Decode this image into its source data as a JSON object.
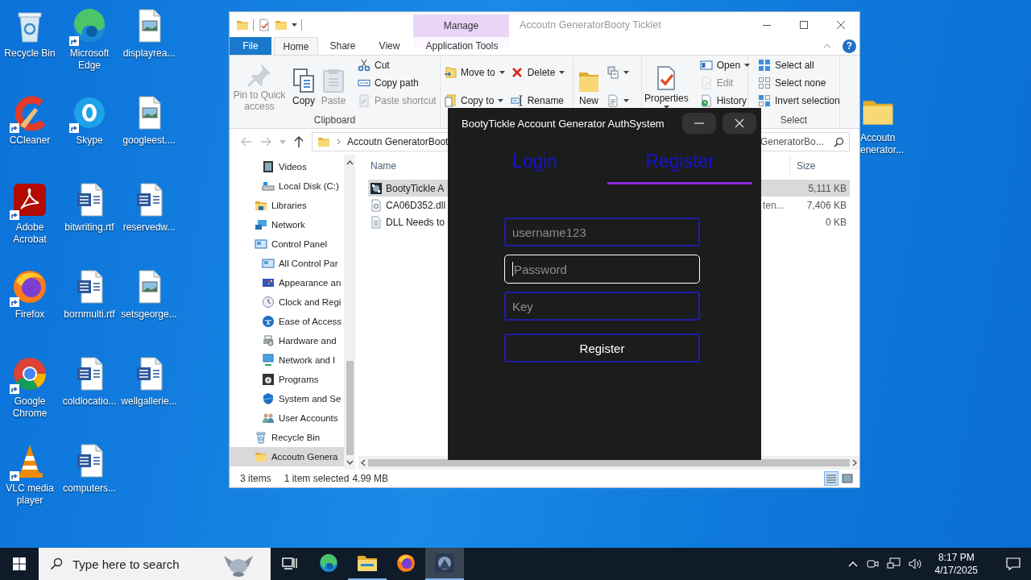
{
  "desktop": {
    "icons": [
      {
        "label": "Recycle Bin",
        "kind": "recycle",
        "shortcut": false
      },
      {
        "label": "CCleaner",
        "kind": "ccleaner",
        "shortcut": true
      },
      {
        "label": "Adobe Acrobat",
        "kind": "acrobat",
        "shortcut": true
      },
      {
        "label": "Firefox",
        "kind": "firefox",
        "shortcut": true
      },
      {
        "label": "Google Chrome",
        "kind": "chrome",
        "shortcut": true
      },
      {
        "label": "VLC media player",
        "kind": "vlc",
        "shortcut": true
      },
      {
        "label": "Microsoft Edge",
        "kind": "edge",
        "shortcut": true
      },
      {
        "label": "Skype",
        "kind": "skype",
        "shortcut": true
      },
      {
        "label": "bitwriting.rtf",
        "kind": "word",
        "shortcut": false
      },
      {
        "label": "bornmulti.rtf",
        "kind": "word",
        "shortcut": false
      },
      {
        "label": "coldlocatio...",
        "kind": "word",
        "shortcut": false
      },
      {
        "label": "computers...",
        "kind": "word",
        "shortcut": false
      },
      {
        "label": "displayrea...",
        "kind": "image",
        "shortcut": false
      },
      {
        "label": "googleest....",
        "kind": "image",
        "shortcut": false
      },
      {
        "label": "reservedw...",
        "kind": "word",
        "shortcut": false
      },
      {
        "label": "setsgeorge...",
        "kind": "image",
        "shortcut": false
      },
      {
        "label": "wellgallerie...",
        "kind": "word",
        "shortcut": false
      }
    ],
    "folder_icon": {
      "label": "Accoutn enerator...",
      "kind": "folder"
    }
  },
  "explorer": {
    "title": "Accoutn GeneratorBooty Ticklet",
    "context_header": "Manage",
    "help": "?",
    "ribbon_tabs": [
      {
        "label": "File",
        "kind": "file",
        "selected": false
      },
      {
        "label": "Home",
        "kind": "plain",
        "selected": true
      },
      {
        "label": "Share",
        "kind": "plain",
        "selected": false
      },
      {
        "label": "View",
        "kind": "plain",
        "selected": false
      },
      {
        "label": "Application Tools",
        "kind": "context",
        "selected": false
      }
    ],
    "ribbon_groups": [
      {
        "label": "Clipboard",
        "columns": [
          [
            {
              "label": "Pin to Quick access",
              "kind": "pin",
              "dropdown": false,
              "disabled": true
            }
          ],
          [
            {
              "label": "Copy",
              "kind": "copy",
              "dropdown": false,
              "disabled": false
            }
          ],
          [
            {
              "label": "Paste",
              "kind": "paste",
              "dropdown": false,
              "disabled": true
            }
          ],
          [
            {
              "label": "Cut",
              "kind": "cut",
              "dropdown": false,
              "disabled": false
            },
            {
              "label": "Copy path",
              "kind": "copypath",
              "dropdown": false,
              "disabled": false
            },
            {
              "label": "Paste shortcut",
              "kind": "pasteshortcut",
              "dropdown": false,
              "disabled": true
            }
          ]
        ]
      },
      {
        "columns": [
          [
            {
              "label": "Move to",
              "kind": "moveto",
              "dropdown": true,
              "disabled": false
            },
            {
              "label": "Copy to",
              "kind": "copyto",
              "dropdown": true,
              "disabled": false
            }
          ],
          [
            {
              "label": "Delete",
              "kind": "delete",
              "dropdown": true,
              "disabled": false
            },
            {
              "label": "Rename",
              "kind": "rename",
              "dropdown": false,
              "disabled": false
            }
          ]
        ]
      },
      {
        "columns": [
          [
            {
              "label": "New",
              "kind": "newfolder",
              "dropdown": false,
              "disabled": false
            }
          ],
          [
            {
              "kind": "newitem",
              "dropdown": true,
              "disabled": false
            },
            {
              "kind": "easyaccess",
              "dropdown": true,
              "disabled": false
            }
          ]
        ]
      },
      {
        "columns": [
          [
            {
              "label": "Properties",
              "kind": "properties",
              "dropdown": true,
              "disabled": false
            }
          ],
          [
            {
              "label": "Open",
              "kind": "open",
              "dropdown": true,
              "disabled": false
            },
            {
              "label": "Edit",
              "kind": "edit",
              "dropdown": false,
              "disabled": true
            },
            {
              "label": "History",
              "kind": "history",
              "dropdown": false,
              "disabled": false
            }
          ]
        ]
      },
      {
        "label": "Select",
        "columns": [
          [
            {
              "label": "Select all",
              "kind": "selectall",
              "dropdown": false,
              "disabled": false
            },
            {
              "label": "Select none",
              "kind": "selectnone",
              "dropdown": false,
              "disabled": false
            },
            {
              "label": "Invert selection",
              "kind": "invert",
              "dropdown": false,
              "disabled": false
            }
          ]
        ]
      }
    ],
    "address": "Accoutn GeneratorBoot",
    "search": "GeneratorBo...",
    "nav": [
      {
        "children": [
          {
            "label": "Videos",
            "kind": "videos",
            "selected": false
          },
          {
            "label": "Local Disk (C:)",
            "kind": "disk",
            "selected": false
          }
        ]
      },
      {
        "label": "Libraries",
        "kind": "libraries",
        "selected": false
      },
      {
        "label": "Network",
        "kind": "network",
        "selected": false
      },
      {
        "label": "Control Panel",
        "kind": "control",
        "selected": false,
        "children": [
          {
            "label": "All Control Par",
            "kind": "control",
            "selected": false
          },
          {
            "label": "Appearance an",
            "kind": "appearance",
            "selected": false
          },
          {
            "label": "Clock and Regi",
            "kind": "clock",
            "selected": false
          },
          {
            "label": "Ease of Access",
            "kind": "ease",
            "selected": false
          },
          {
            "label": "Hardware and",
            "kind": "hardware",
            "selected": false
          },
          {
            "label": "Network and I",
            "kind": "netinternet",
            "selected": false
          },
          {
            "label": "Programs",
            "kind": "programs",
            "selected": false
          },
          {
            "label": "System and Se",
            "kind": "system",
            "selected": false
          },
          {
            "label": "User Accounts",
            "kind": "users",
            "selected": false
          }
        ]
      },
      {
        "label": "Recycle Bin",
        "kind": "recycle",
        "selected": false
      },
      {
        "label": "Accoutn Genera",
        "kind": "folder",
        "selected": true
      }
    ],
    "columns": [
      "Name",
      "Size"
    ],
    "files": [
      {
        "name": "BootyTickle A",
        "kind": "app",
        "size": "5,111 KB",
        "selected": true
      },
      {
        "name": "CA06D352.dll",
        "kind": "dll",
        "type": "ten...",
        "size": "7,406 KB",
        "selected": false
      },
      {
        "name": "DLL Needs to",
        "kind": "text",
        "size": "0 KB",
        "selected": false
      }
    ],
    "status": {
      "count": "3 items",
      "selection": "1 item selected",
      "size": "4.99 MB"
    },
    "views": [
      {
        "kind": "details",
        "selected": true
      },
      {
        "kind": "tiles",
        "selected": false
      }
    ]
  },
  "auth_dialog": {
    "title": "BootyTickle Account Generator AuthSystem",
    "tabs": [
      {
        "label": "Login",
        "selected": false
      },
      {
        "label": "Register",
        "selected": true
      }
    ],
    "fields": [
      {
        "placeholder": "username123",
        "focused": false
      },
      {
        "placeholder": "Password",
        "focused": true
      },
      {
        "placeholder": "Key",
        "focused": false
      }
    ],
    "submit": "Register"
  },
  "taskbar": {
    "search_placeholder": "Type here to search",
    "apps": [
      {
        "kind": "taskview",
        "running": false,
        "active": false
      },
      {
        "kind": "edge",
        "running": false,
        "active": false
      },
      {
        "kind": "explorer",
        "running": true,
        "active": false
      },
      {
        "kind": "firefox",
        "running": false,
        "active": false
      },
      {
        "kind": "app",
        "running": true,
        "active": true
      }
    ],
    "time": "8:17 PM",
    "date": "4/17/2025"
  }
}
